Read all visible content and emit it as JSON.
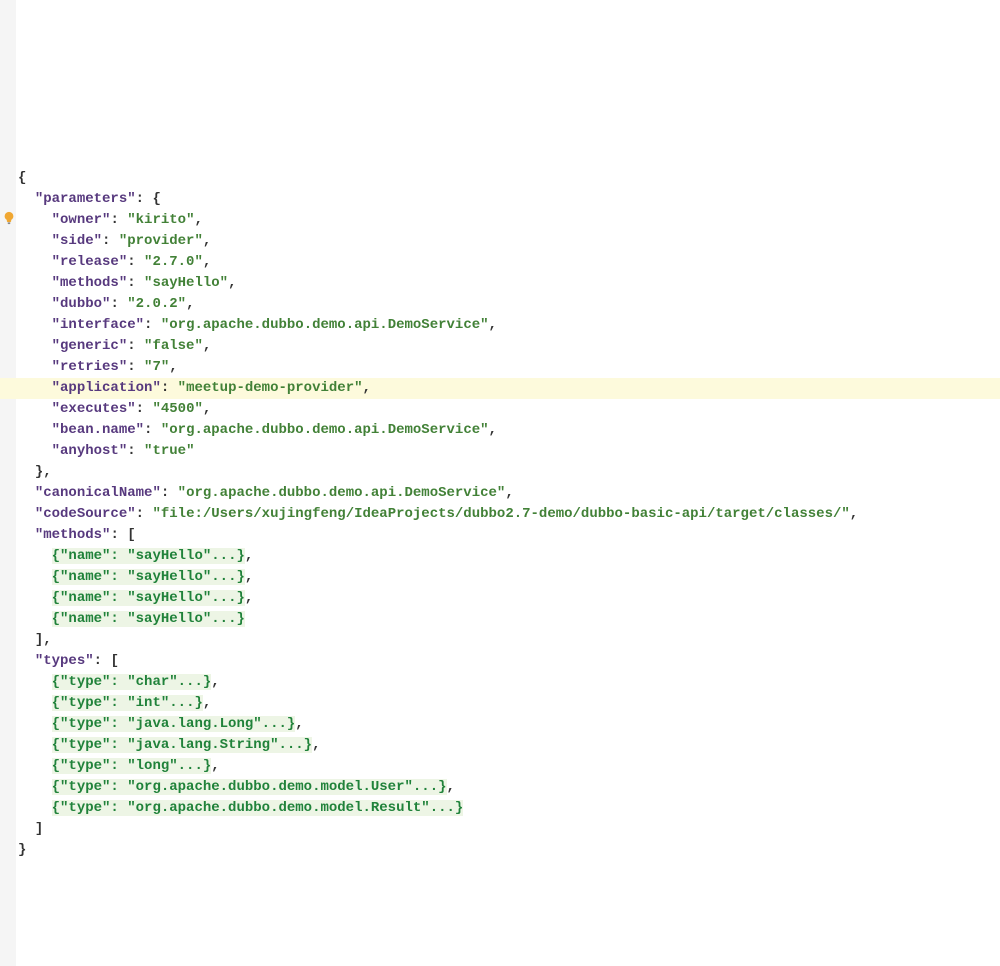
{
  "code": {
    "parameters_label": "parameters",
    "parameters": {
      "owner_k": "owner",
      "owner_v": "kirito",
      "side_k": "side",
      "side_v": "provider",
      "release_k": "release",
      "release_v": "2.7.0",
      "methods_k": "methods",
      "methods_v": "sayHello",
      "dubbo_k": "dubbo",
      "dubbo_v": "2.0.2",
      "interface_k": "interface",
      "interface_v": "org.apache.dubbo.demo.api.DemoService",
      "generic_k": "generic",
      "generic_v": "false",
      "retries_k": "retries",
      "retries_v": "7",
      "application_k": "application",
      "application_v": "meetup-demo-provider",
      "executes_k": "executes",
      "executes_v": "4500",
      "beanname_k": "bean.name",
      "beanname_v": "org.apache.dubbo.demo.api.DemoService",
      "anyhost_k": "anyhost",
      "anyhost_v": "true"
    },
    "canonicalName_k": "canonicalName",
    "canonicalName_v": "org.apache.dubbo.demo.api.DemoService",
    "codeSource_k": "codeSource",
    "codeSource_v": "file:/Users/xujingfeng/IdeaProjects/dubbo2.7-demo/dubbo-basic-api/target/classes/",
    "methods_label": "methods",
    "methods_arr": [
      {
        "name_k": "name",
        "name_v": "sayHello"
      },
      {
        "name_k": "name",
        "name_v": "sayHello"
      },
      {
        "name_k": "name",
        "name_v": "sayHello"
      },
      {
        "name_k": "name",
        "name_v": "sayHello"
      }
    ],
    "types_label": "types",
    "types_arr": [
      {
        "type_k": "type",
        "type_v": "char"
      },
      {
        "type_k": "type",
        "type_v": "int"
      },
      {
        "type_k": "type",
        "type_v": "java.lang.Long"
      },
      {
        "type_k": "type",
        "type_v": "java.lang.String"
      },
      {
        "type_k": "type",
        "type_v": "long"
      },
      {
        "type_k": "type",
        "type_v": "org.apache.dubbo.demo.model.User"
      },
      {
        "type_k": "type",
        "type_v": "org.apache.dubbo.demo.model.Result"
      }
    ]
  }
}
